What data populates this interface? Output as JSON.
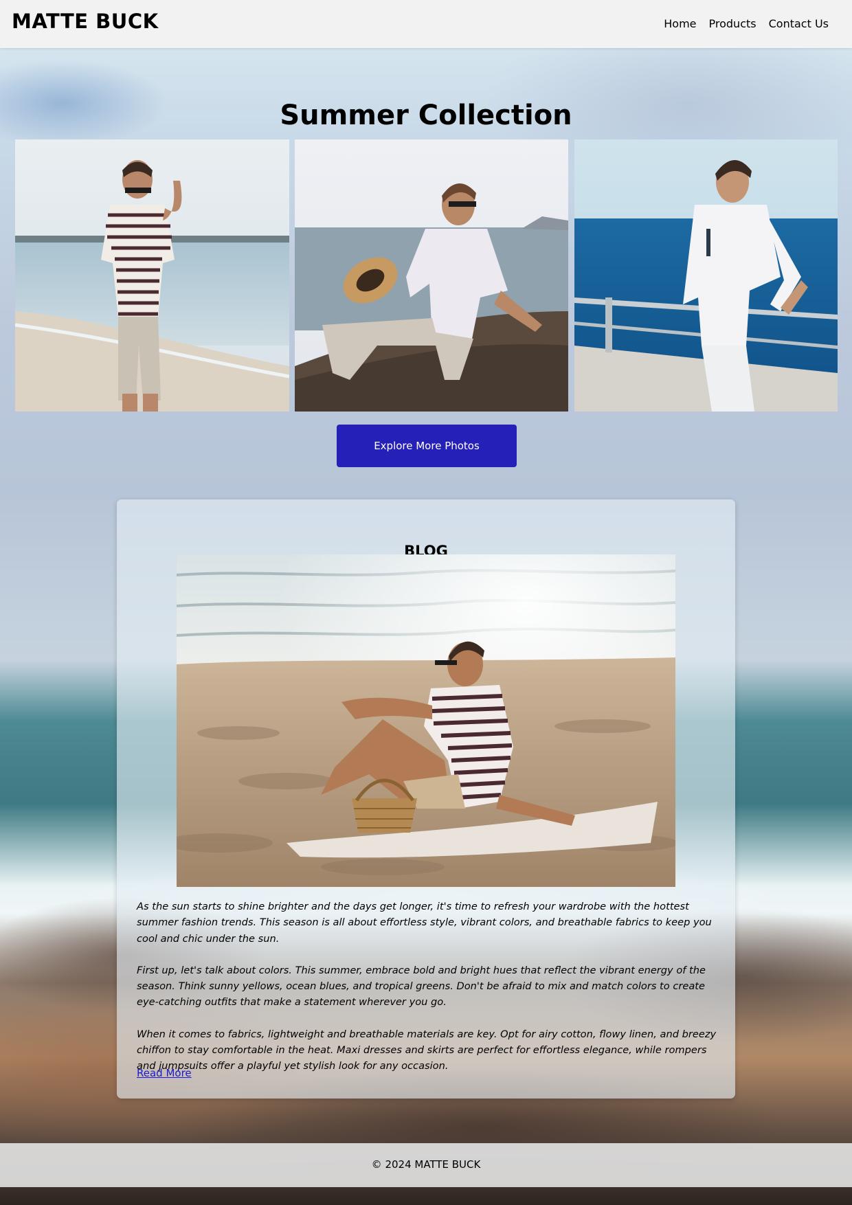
{
  "header": {
    "brand": "MATTE BUCK",
    "nav": [
      "Home",
      "Products",
      "Contact Us"
    ]
  },
  "hero": {
    "title": "Summer Collection",
    "photos": [
      "man in striped t-shirt on beach",
      "man in white shirt sitting on rock with straw hat",
      "man in white outfit on boat deck"
    ],
    "button_label": "Explore More Photos"
  },
  "blog": {
    "heading": "BLOG",
    "image": "man in striped shirt sitting on beach blanket with wicker basket",
    "paragraphs": [
      "As the sun starts to shine brighter and the days get longer, it's time to refresh your wardrobe with the hottest summer fashion trends. This season is all about effortless style, vibrant colors, and breathable fabrics to keep you cool and chic under the sun.",
      "First up, let's talk about colors. This summer, embrace bold and bright hues that reflect the vibrant energy of the season. Think sunny yellows, ocean blues, and tropical greens. Don't be afraid to mix and match colors to create eye-catching outfits that make a statement wherever you go.",
      "When it comes to fabrics, lightweight and breathable materials are key. Opt for airy cotton, flowy linen, and breezy chiffon to stay comfortable in the heat. Maxi dresses and skirts are perfect for effortless elegance, while rompers and jumpsuits offer a playful yet stylish look for any occasion."
    ],
    "read_more": "Read More"
  },
  "footer": {
    "copyright": "© 2024 MATTE BUCK"
  },
  "colors": {
    "header_bg": "#f2f2f2",
    "button_bg": "#2521b8",
    "link": "#1a1ad4"
  }
}
